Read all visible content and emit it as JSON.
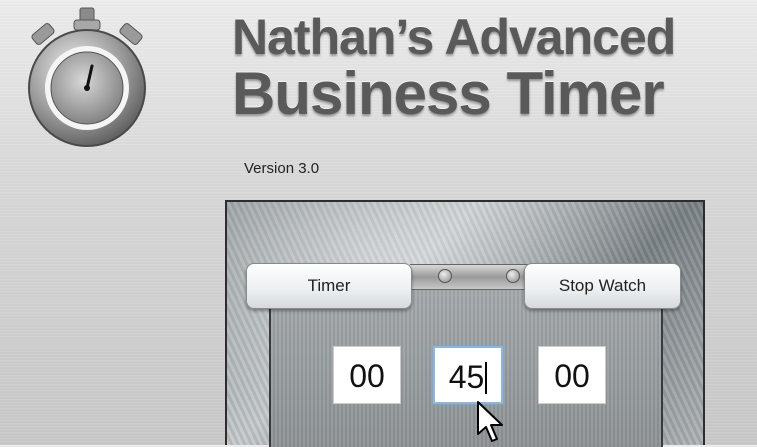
{
  "app": {
    "title_line1": "Nathan’s Advanced",
    "title_line2": "Business Timer",
    "version": "Version 3.0"
  },
  "mode_tabs": [
    {
      "label": "Timer"
    },
    {
      "label": "Stop Watch"
    }
  ],
  "time_fields": {
    "hours": "00",
    "minutes": "45",
    "seconds": "00",
    "focused": "minutes"
  },
  "icons": {
    "logo": "stopwatch-icon",
    "pointer": "mouse-pointer-icon"
  },
  "colors": {
    "title": "#5a5a5a",
    "focus_border": "#8fb6d8"
  }
}
